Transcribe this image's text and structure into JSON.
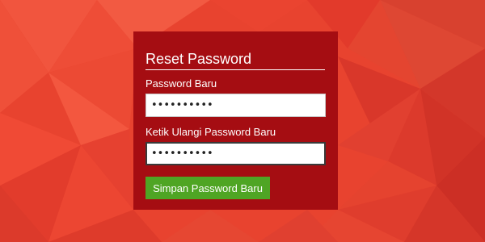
{
  "form": {
    "title": "Reset Password",
    "new_password": {
      "label": "Password Baru",
      "value": "••••••••••"
    },
    "confirm_password": {
      "label": "Ketik Ulangi Password Baru",
      "value": "••••••••••"
    },
    "submit_label": "Simpan Password Baru"
  },
  "colors": {
    "panel_bg": "#a50d12",
    "button_bg": "#4fa524",
    "background_base": "#e8432f"
  }
}
